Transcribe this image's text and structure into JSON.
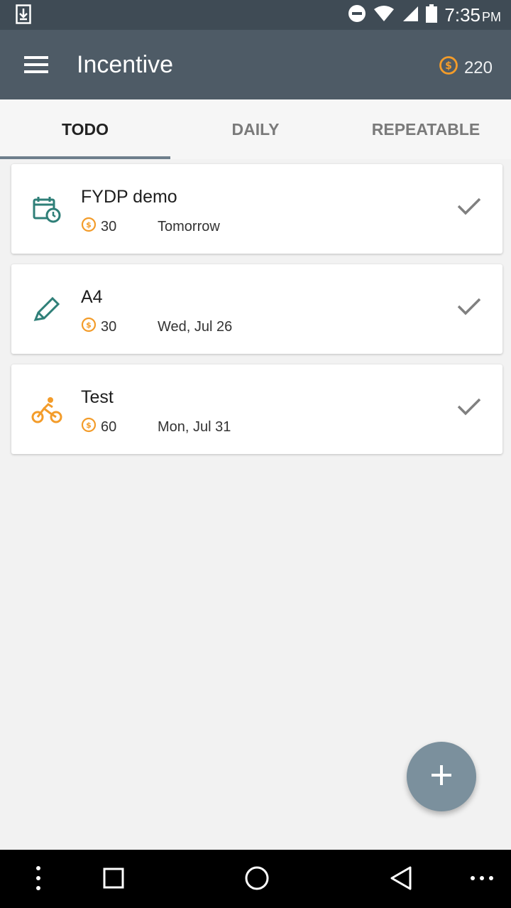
{
  "status_bar": {
    "time": "7:35",
    "ampm": "PM"
  },
  "app_bar": {
    "title": "Incentive",
    "balance": "220"
  },
  "tabs": [
    {
      "label": "TODO",
      "active": true
    },
    {
      "label": "DAILY",
      "active": false
    },
    {
      "label": "REPEATABLE",
      "active": false
    }
  ],
  "tasks": [
    {
      "name": "FYDP demo",
      "points": "30",
      "due": "Tomorrow",
      "icon": "calendar-clock-icon"
    },
    {
      "name": "A4",
      "points": "30",
      "due": "Wed, Jul 26",
      "icon": "pencil-icon"
    },
    {
      "name": "Test",
      "points": "60",
      "due": "Mon, Jul 31",
      "icon": "bike-icon"
    }
  ],
  "fab": {
    "icon": "plus-icon"
  },
  "colors": {
    "app_bar": "#4e5b66",
    "status_bar": "#3f4b55",
    "coin": "#f39c2a",
    "accent": "#6e7f8c",
    "task_icon_teal": "#2f7f78",
    "task_icon_orange": "#f39c2a"
  }
}
